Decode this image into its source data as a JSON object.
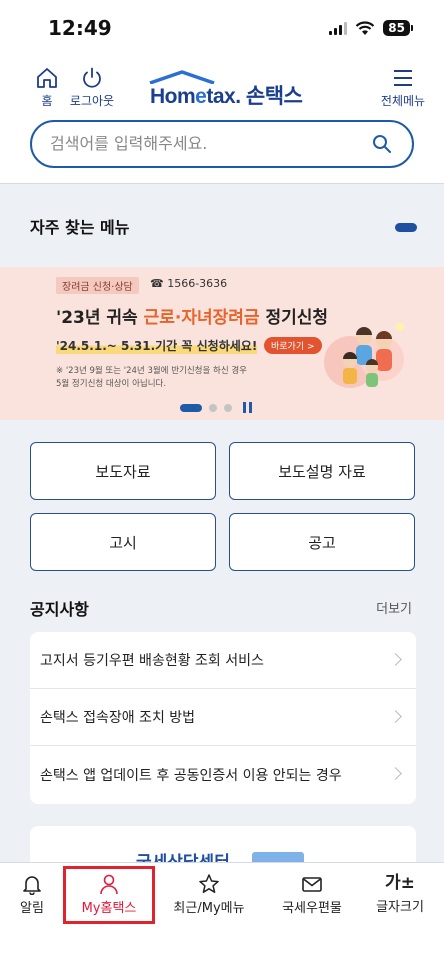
{
  "status": {
    "time": "12:49",
    "battery": "85"
  },
  "header": {
    "home_label": "홈",
    "logout_label": "로그아웃",
    "logo_prefix": "Hom",
    "logo_mid": "e",
    "logo_suffix": "tax.",
    "logo_korean": "손택스",
    "menu_label": "전체메뉴",
    "brand_color": "#1b3f8f"
  },
  "search": {
    "placeholder": "검색어를 입력해주세요."
  },
  "favorites": {
    "title": "자주 찾는 메뉴"
  },
  "banner": {
    "tag": "장려금 신청·상담",
    "phone": "☎ 1566-3636",
    "headline_pre": "'23년 귀속 ",
    "headline_highlight": "근로·자녀장려금",
    "headline_post": " 정기신청",
    "period": "'24.5.1.~ 5.31.기간 꼭 신청하세요!",
    "go_label": "바로가기 >",
    "note_line1": "※ '23년 9월 또는 '24년 3월에 반기신청을 하신 경우",
    "note_line2": "5월 정기신청 대상이 아닙니다."
  },
  "quick_buttons": [
    "보도자료",
    "보도설명 자료",
    "고시",
    "공고"
  ],
  "notices": {
    "title": "공지사항",
    "more": "더보기",
    "items": [
      "고지서 등기우편 배송현황 조회 서비스",
      "손택스 접속장애 조치 방법",
      "손택스 앱 업데이트 후 공동인증서 이용 안되는 경우"
    ]
  },
  "center_card": {
    "label": "국세상담센터"
  },
  "tabbar": {
    "tabs": [
      "알림",
      "My홈택스",
      "최근/My메뉴",
      "국세우편물",
      "글자크기"
    ],
    "font_glyph": "가±",
    "active_color": "#e4193b"
  }
}
